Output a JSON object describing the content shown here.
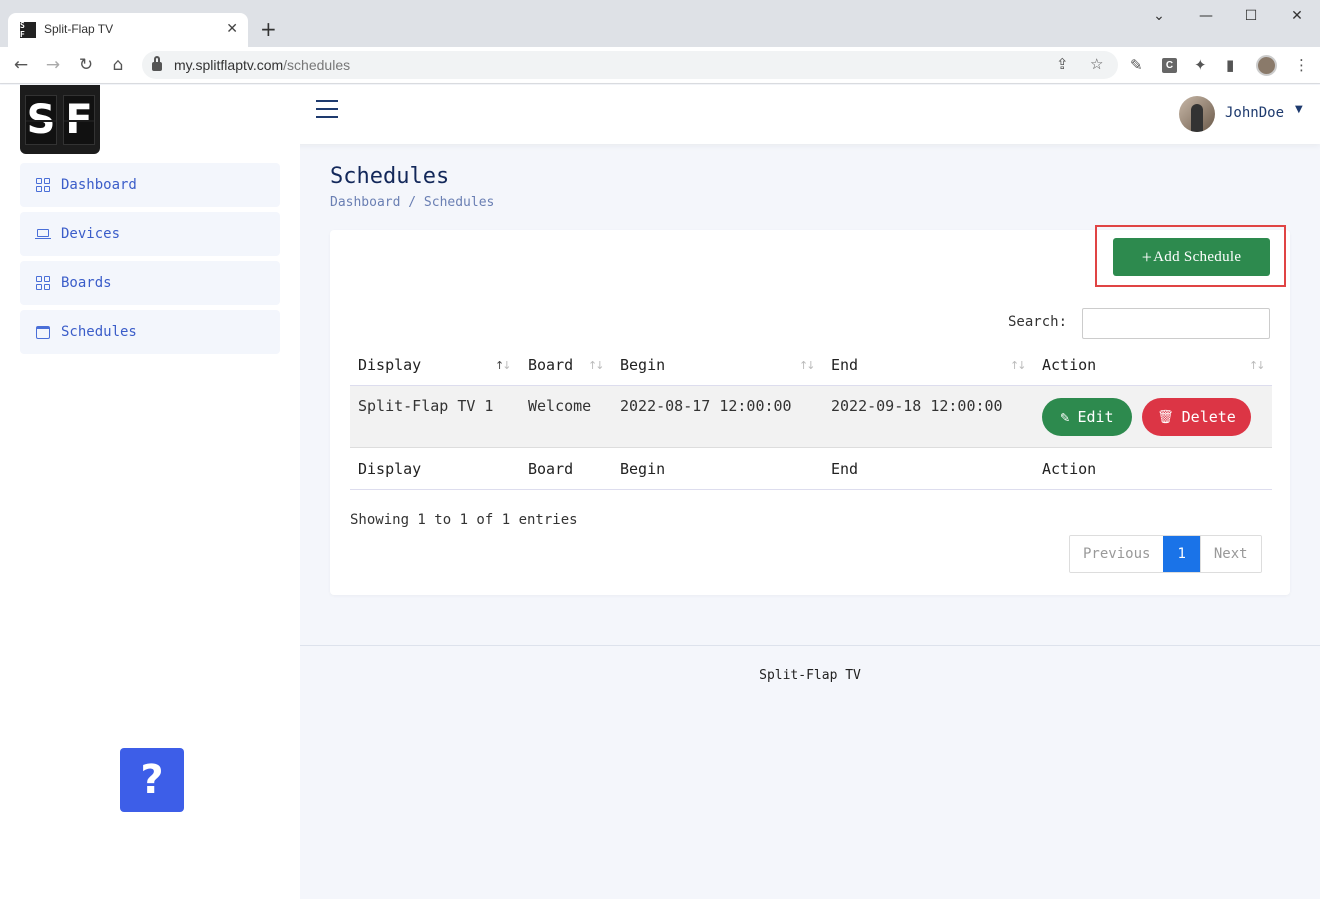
{
  "browser": {
    "tab_title": "Split-Flap TV",
    "tab_favicon": "S F",
    "url_host": "my.splitflaptv.com",
    "url_path": "/schedules"
  },
  "brand": {
    "logo_left": "S",
    "logo_right": "F"
  },
  "user": {
    "name": "JohnDoe"
  },
  "sidebar": {
    "items": [
      {
        "label": "Dashboard",
        "icon": "grid-icon"
      },
      {
        "label": "Devices",
        "icon": "laptop-icon"
      },
      {
        "label": "Boards",
        "icon": "grid-icon"
      },
      {
        "label": "Schedules",
        "icon": "calendar-icon"
      }
    ],
    "help_label": "?"
  },
  "page": {
    "title": "Schedules",
    "breadcrumb": "Dashboard / Schedules",
    "add_button": "Add Schedule",
    "search_label": "Search:",
    "search_value": ""
  },
  "table": {
    "columns": [
      "Display",
      "Board",
      "Begin",
      "End",
      "Action"
    ],
    "rows": [
      {
        "display": "Split-Flap TV 1",
        "board": "Welcome",
        "begin": "2022-08-17 12:00:00",
        "end": "2022-09-18 12:00:00"
      }
    ],
    "edit_label": "Edit",
    "delete_label": "Delete",
    "showing": "Showing 1 to 1 of 1 entries",
    "pagination": {
      "previous": "Previous",
      "current": "1",
      "next": "Next"
    }
  },
  "footer": {
    "text": "Split-Flap TV"
  },
  "colors": {
    "add_button": "#2d8a4e",
    "edit_button": "#2d8a4e",
    "delete_button": "#dc3545",
    "highlight_box": "#e04444",
    "pagination_active": "#1a73e8",
    "help_button": "#3d5ee8",
    "sidebar_text": "#3b5dc9"
  }
}
